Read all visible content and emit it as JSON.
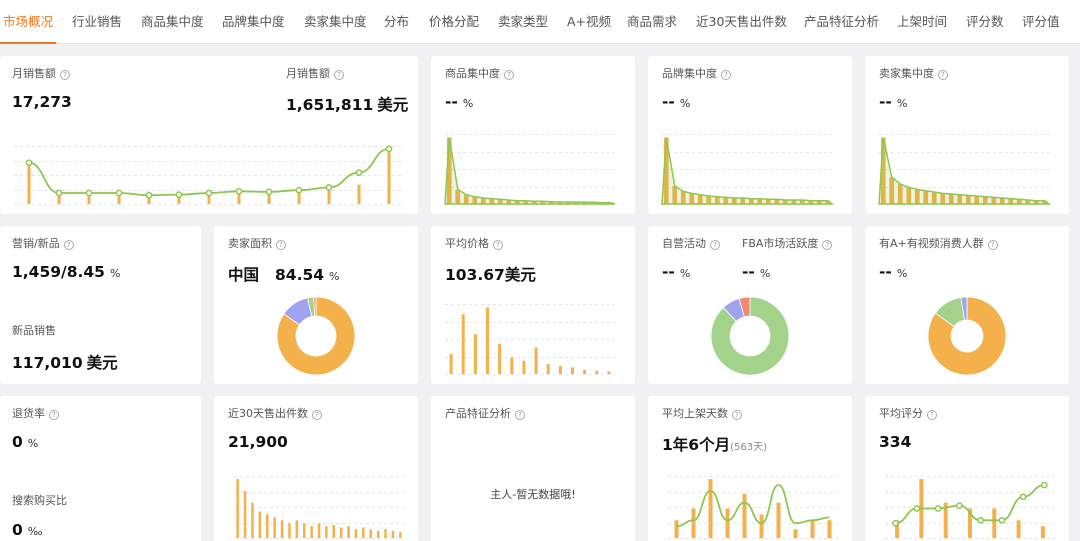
{
  "tabs": [
    "市场概况",
    "行业销售",
    "商品集中度",
    "品牌集中度",
    "卖家集中度",
    "分布",
    "价格分配",
    "卖家类型",
    "A+视频",
    "商品需求",
    "近30天售出件数",
    "产品特征分析",
    "上架时间",
    "评分数",
    "评分值"
  ],
  "active_tab": "市场概况",
  "cards": {
    "monthly_sales": {
      "label": "月销售额",
      "value": "17,273"
    },
    "monthly_revenue": {
      "label": "月销售额",
      "value": "1,651,811",
      "unit": "美元"
    },
    "product_conc": {
      "label": "商品集中度",
      "value": "--",
      "unit": "%"
    },
    "brand_conc": {
      "label": "品牌集中度",
      "value": "--",
      "unit": "%"
    },
    "seller_conc": {
      "label": "卖家集中度",
      "value": "--",
      "unit": "%"
    },
    "marketing_new": {
      "label": "营销/新品",
      "value": "1,459/8.45",
      "unit": "%",
      "label2": "新品销售",
      "value2": "117,010",
      "unit2": "美元"
    },
    "seller_area": {
      "label": "卖家面积",
      "country": "中国",
      "value": "84.54",
      "unit": "%"
    },
    "avg_price": {
      "label": "平均价格",
      "value": "103.67美元"
    },
    "self_op": {
      "label": "自营活动",
      "value": "--",
      "unit": "%",
      "label2": "FBA市场活跃度",
      "value2": "--",
      "unit2": "%"
    },
    "aplus": {
      "label": "有A+有视频消费人群",
      "value": "--",
      "unit": "%"
    },
    "return_rate": {
      "label": "退货率",
      "value": "0",
      "unit": "%",
      "label2": "搜索购买比",
      "value2": "0",
      "unit2": "‰"
    },
    "sold_30d": {
      "label": "近30天售出件数",
      "value": "21,900"
    },
    "features": {
      "label": "产品特征分析",
      "empty": "主人-暂无数据哦!"
    },
    "avg_days": {
      "label": "平均上架天数",
      "value": "1年6个月",
      "sub": "(563天)"
    },
    "avg_rating": {
      "label": "平均评分",
      "value": "334"
    }
  },
  "colors": {
    "accent": "#f0781e",
    "bar": "#f4b04a",
    "line": "#8cc850",
    "donut_green": "#a3d28a",
    "donut_purple": "#a0a4f0",
    "donut_red": "#f08a6e"
  },
  "chart_data": [
    {
      "type": "bar",
      "title": "月销售额",
      "values": [
        0.7,
        0.25,
        0.2,
        0.2,
        0.18,
        0.2,
        0.2,
        0.22,
        0.25,
        0.25,
        0.25,
        0.35,
        1.0
      ],
      "line": [
        0.75,
        0.2,
        0.2,
        0.2,
        0.16,
        0.17,
        0.2,
        0.23,
        0.22,
        0.25,
        0.3,
        0.57,
        1.0
      ]
    },
    {
      "type": "bar",
      "title": "商品集中度",
      "values": [
        1.0,
        0.22,
        0.14,
        0.11,
        0.09,
        0.08,
        0.07,
        0.06,
        0.05,
        0.05,
        0.04,
        0.04,
        0.035,
        0.03,
        0.03,
        0.03,
        0.025,
        0.025,
        0.02,
        0.02
      ]
    },
    {
      "type": "bar",
      "title": "品牌集中度",
      "values": [
        1.0,
        0.27,
        0.19,
        0.16,
        0.14,
        0.12,
        0.11,
        0.1,
        0.09,
        0.09,
        0.08,
        0.08,
        0.07,
        0.07,
        0.06,
        0.06,
        0.06,
        0.05,
        0.05,
        0.05
      ]
    },
    {
      "type": "bar",
      "title": "卖家集中度",
      "values": [
        1.0,
        0.4,
        0.3,
        0.25,
        0.22,
        0.2,
        0.18,
        0.16,
        0.15,
        0.14,
        0.13,
        0.12,
        0.11,
        0.1,
        0.09,
        0.08,
        0.07,
        0.06,
        0.05,
        0.05
      ]
    },
    {
      "type": "pie",
      "title": "卖家面积",
      "values": [
        84.54,
        12.0,
        2.5,
        0.96
      ]
    },
    {
      "type": "bar",
      "title": "平均价格",
      "values": [
        0.3,
        0.9,
        0.6,
        1.0,
        0.45,
        0.25,
        0.2,
        0.4,
        0.15,
        0.12,
        0.1,
        0.06,
        0.05,
        0.04
      ]
    },
    {
      "type": "pie",
      "title": "自营活动",
      "values": [
        88,
        7.5,
        4.5
      ]
    },
    {
      "type": "pie",
      "title": "有A+有视频消费人群",
      "values": [
        85,
        12.5,
        2.5
      ]
    },
    {
      "type": "bar",
      "title": "近30天售出件数",
      "values": [
        1.0,
        0.8,
        0.6,
        0.45,
        0.4,
        0.35,
        0.3,
        0.25,
        0.3,
        0.25,
        0.2,
        0.25,
        0.2,
        0.22,
        0.18,
        0.2,
        0.15,
        0.18,
        0.15,
        0.12,
        0.15,
        0.12,
        0.1
      ]
    },
    {
      "type": "bar",
      "title": "平均上架天数",
      "values": [
        0.3,
        0.5,
        1.0,
        0.5,
        0.75,
        0.4,
        0.6,
        0.15,
        0.3,
        0.3
      ],
      "line": [
        0.2,
        0.3,
        0.8,
        0.3,
        0.6,
        0.25,
        0.9,
        0.25,
        0.3,
        0.35
      ]
    },
    {
      "type": "bar",
      "title": "平均评分",
      "values": [
        0.3,
        1.0,
        0.6,
        0.5,
        0.5,
        0.3,
        0.2
      ],
      "line": [
        0.25,
        0.5,
        0.5,
        0.55,
        0.3,
        0.3,
        0.7,
        0.9
      ]
    }
  ]
}
